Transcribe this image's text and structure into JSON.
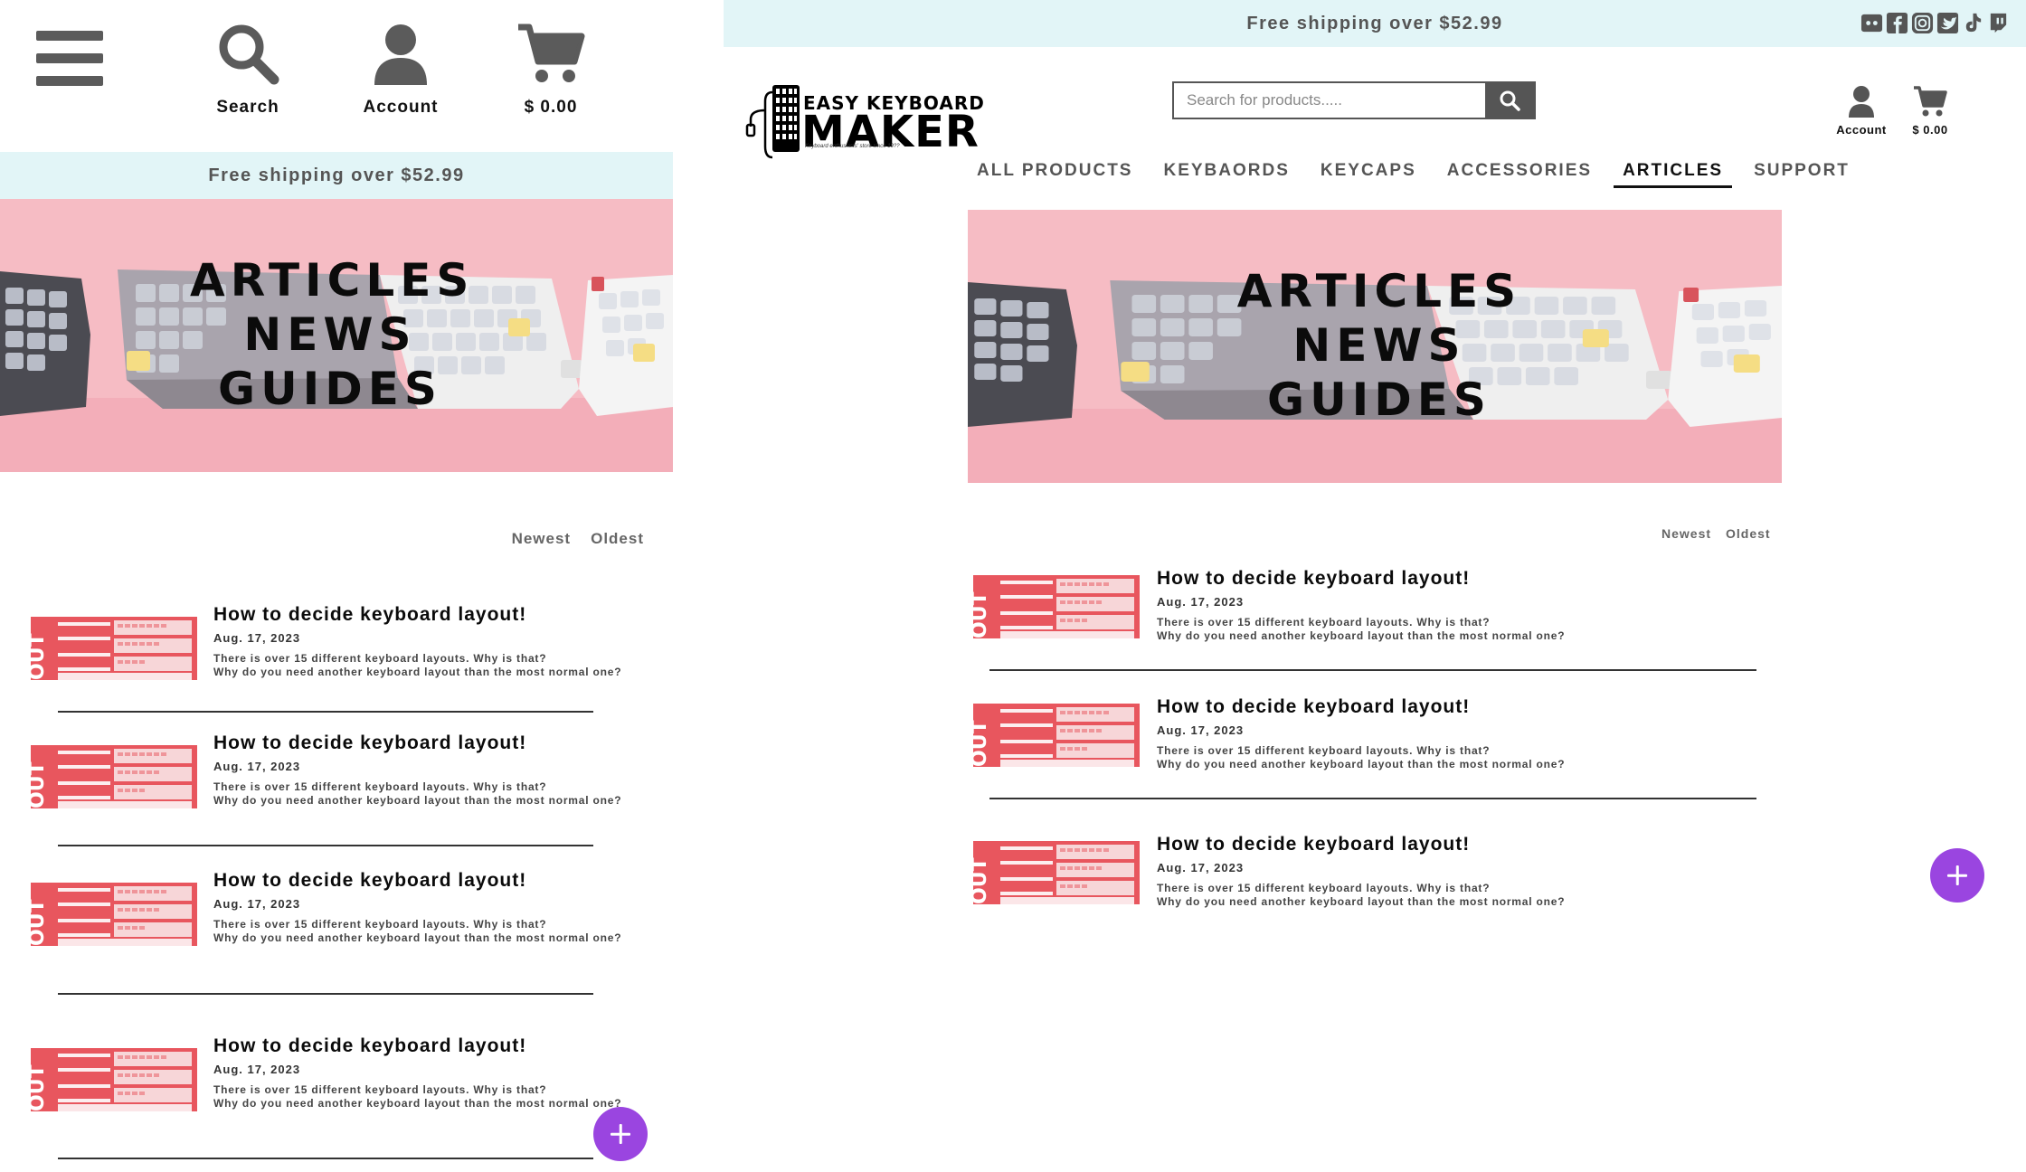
{
  "mobile": {
    "top_icons": [
      {
        "label": "Search"
      },
      {
        "label": "Account"
      },
      {
        "label": "$ 0.00"
      }
    ],
    "shipping_banner": "Free shipping over $52.99",
    "hero": {
      "line1": "ARTICLES",
      "line2": "NEWS",
      "line3": "GUIDES"
    },
    "sort": {
      "newest": "Newest",
      "oldest": "Oldest"
    },
    "articles": [
      {
        "title": "How to decide keyboard layout!",
        "date": "Aug. 17, 2023",
        "excerpt1": "There is over 15 different keyboard layouts. Why is that?",
        "excerpt2": "Why do you need another keyboard layout than the most normal one?",
        "thumb_text": "OUT"
      },
      {
        "title": "How to decide keyboard layout!",
        "date": "Aug. 17, 2023",
        "excerpt1": "There is over 15 different keyboard layouts. Why is that?",
        "excerpt2": "Why do you need another keyboard layout than the most normal one?",
        "thumb_text": "OUT"
      },
      {
        "title": "How to decide keyboard layout!",
        "date": "Aug. 17, 2023",
        "excerpt1": "There is over 15 different keyboard layouts. Why is that?",
        "excerpt2": "Why do you need another keyboard layout than the most normal one?",
        "thumb_text": "OUT"
      },
      {
        "title": "How to decide keyboard layout!",
        "date": "Aug. 17, 2023",
        "excerpt1": "There is over 15 different keyboard layouts. Why is that?",
        "excerpt2": "Why do you need another keyboard layout than the most normal one?",
        "thumb_text": "OUT"
      }
    ]
  },
  "desktop": {
    "shipping_banner": "Free shipping over $52.99",
    "social_icons": [
      "discord-icon",
      "facebook-icon",
      "instagram-icon",
      "twitter-icon",
      "tiktok-icon",
      "twitch-icon"
    ],
    "logo": {
      "line1": "EASY KEYBOARD",
      "line2": "MAKER",
      "tagline": "Keyboard enthusiasts' store since 19??"
    },
    "search": {
      "placeholder": "Search for products....."
    },
    "account_label": "Account",
    "cart_label": "$ 0.00",
    "nav": [
      "ALL PRODUCTS",
      "KEYBAORDS",
      "KEYCAPS",
      "ACCESSORIES",
      "ARTICLES",
      "SUPPORT"
    ],
    "active_nav": "ARTICLES",
    "hero": {
      "line1": "ARTICLES",
      "line2": "NEWS",
      "line3": "GUIDES"
    },
    "sort": {
      "newest": "Newest",
      "oldest": "Oldest"
    },
    "articles": [
      {
        "title": "How to decide keyboard layout!",
        "date": "Aug. 17, 2023",
        "excerpt1": "There is over 15 different keyboard layouts. Why is that?",
        "excerpt2": "Why do you need another keyboard layout than the most normal one?",
        "thumb_text": "OUT"
      },
      {
        "title": "How to decide keyboard layout!",
        "date": "Aug. 17, 2023",
        "excerpt1": "There is over 15 different keyboard layouts. Why is that?",
        "excerpt2": "Why do you need another keyboard layout than the most normal one?",
        "thumb_text": "OUT"
      },
      {
        "title": "How to decide keyboard layout!",
        "date": "Aug. 17, 2023",
        "excerpt1": "There is over 15 different keyboard layouts. Why is that?",
        "excerpt2": "Why do you need another keyboard layout than the most normal one?",
        "thumb_text": "OUT"
      }
    ]
  },
  "colors": {
    "shipping_bg": "#e2f5f7",
    "hero_pink": "#f6bcc4",
    "fab_purple": "#9a45e0",
    "thumb_red": "#e8565e",
    "icon_gray": "#5b5b5b"
  }
}
